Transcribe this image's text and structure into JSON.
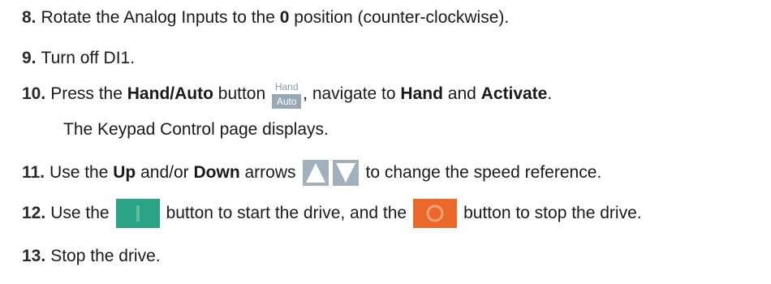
{
  "steps": [
    {
      "number": "8.",
      "parts": [
        "Rotate the Analog Inputs to the ",
        "0",
        " position (counter-clockwise)."
      ]
    },
    {
      "number": "9.",
      "parts": [
        "Turn off DI1."
      ]
    },
    {
      "number": "10.",
      "parts": [
        "Press the ",
        "Hand/Auto",
        " button ",
        ", navigate to ",
        "Hand",
        " and ",
        "Activate",
        "."
      ],
      "subtext": "The Keypad Control page displays."
    },
    {
      "number": "11.",
      "parts": [
        "Use the ",
        "Up",
        " and/or ",
        "Down",
        " arrows ",
        " to change the speed reference."
      ]
    },
    {
      "number": "12.",
      "parts": [
        "Use the ",
        " button to start the drive, and the ",
        " button to stop the drive."
      ]
    },
    {
      "number": "13.",
      "parts": [
        "Stop the drive."
      ]
    }
  ],
  "icons": {
    "hand_auto": {
      "top_label": "Hand",
      "bottom_label": "Auto"
    },
    "arrows": [
      "up-arrow-icon",
      "down-arrow-icon"
    ],
    "start": "start-button-icon",
    "stop": "stop-button-icon"
  },
  "colors": {
    "start_green": "#2aa386",
    "stop_orange": "#e9682a",
    "key_gray": "#a2b0bc"
  }
}
